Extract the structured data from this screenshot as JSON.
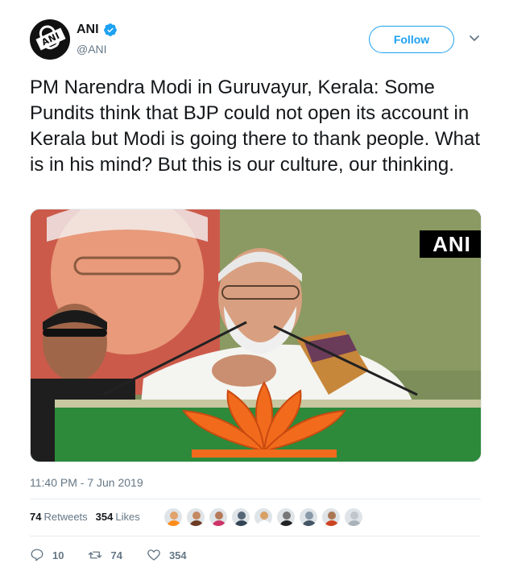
{
  "account": {
    "name": "ANI",
    "handle": "@ANI",
    "avatar_icon": "ani-logo-icon",
    "verified_icon": "verified-badge-icon",
    "avatar_text": "ANI"
  },
  "follow": {
    "label": "Follow"
  },
  "more": {
    "icon": "chevron-down-icon"
  },
  "tweet": {
    "text": "PM Narendra Modi in Guruvayur, Kerala: Some Pundits think that BJP could not open its account in Kerala but Modi is going there to thank people. What is in his mind? But this is our culture, our thinking."
  },
  "media": {
    "watermark": "ANI"
  },
  "timestamp": "11:40 PM - 7 Jun 2019",
  "stats": {
    "retweets_count": "74",
    "retweets_label": "Retweets",
    "likes_count": "354",
    "likes_label": "Likes"
  },
  "likers": [
    {
      "head": "#e0a36b",
      "body": "#ff8c1a"
    },
    {
      "head": "#c48a63",
      "body": "#6b3b22"
    },
    {
      "head": "#b57a5a",
      "body": "#cc3366"
    },
    {
      "head": "#556677",
      "body": "#334455"
    },
    {
      "head": "#d9a066",
      "body": "#ffffff"
    },
    {
      "head": "#777777",
      "body": "#222222"
    },
    {
      "head": "#8899aa",
      "body": "#445566"
    },
    {
      "head": "#aa7755",
      "body": "#cc4422"
    },
    {
      "head": "#c0c6cc",
      "body": "#aab2ba"
    }
  ],
  "actions": {
    "reply_count": "10",
    "retweet_count": "74",
    "like_count": "354"
  },
  "colors": {
    "accent": "#1da1f2",
    "secondary_text": "#657786",
    "border": "#e6ecf0"
  }
}
